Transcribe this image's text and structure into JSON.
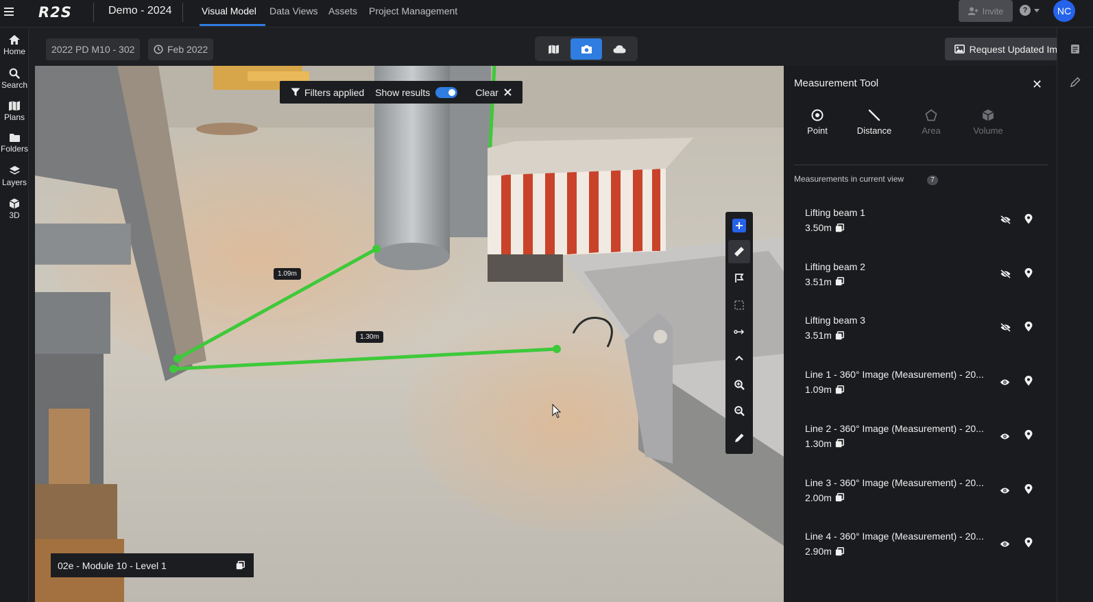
{
  "header": {
    "logo": "R2S",
    "project_title": "Demo - 2024",
    "tabs": [
      {
        "label": "Visual Model",
        "active": true
      },
      {
        "label": "Data Views"
      },
      {
        "label": "Assets"
      },
      {
        "label": "Project Management"
      }
    ],
    "invite_label": "Invite",
    "help_label": "?",
    "avatar_initials": "NC"
  },
  "left_rail": {
    "items": [
      {
        "label": "Home",
        "icon": "home-icon"
      },
      {
        "label": "Search",
        "icon": "search-icon"
      },
      {
        "label": "Plans",
        "icon": "map-icon"
      },
      {
        "label": "Folders",
        "icon": "folder-icon"
      },
      {
        "label": "Layers",
        "icon": "layers-icon"
      },
      {
        "label": "3D",
        "icon": "cube-icon"
      }
    ]
  },
  "subbar": {
    "scan_chip": "2022 PD M10 - 302",
    "date_chip": "Feb 2022",
    "view_modes": [
      "map-icon",
      "camera-icon",
      "cloud-icon"
    ],
    "active_view_mode": "camera-icon",
    "request_label": "Request Updated Images"
  },
  "viewer": {
    "filters_label": "Filters applied",
    "show_results_label": "Show results",
    "show_results_on": true,
    "clear_label": "Clear",
    "measure_labels": [
      "1.09m",
      "1.30m"
    ],
    "location_label": "02e - Module 10 - Level 1",
    "line_color": "#3ec93a"
  },
  "measurement_panel": {
    "title": "Measurement Tool",
    "tools": [
      {
        "label": "Point",
        "enabled": true
      },
      {
        "label": "Distance",
        "enabled": true
      },
      {
        "label": "Area",
        "enabled": false
      },
      {
        "label": "Volume",
        "enabled": false
      }
    ],
    "section_label": "Measurements in current view",
    "count": "7",
    "items": [
      {
        "name": "Lifting beam 1",
        "value": "3.50m",
        "visible": false
      },
      {
        "name": "Lifting beam 2",
        "value": "3.51m",
        "visible": false
      },
      {
        "name": "Lifting beam 3",
        "value": "3.51m",
        "visible": false
      },
      {
        "name": "Line 1 - 360° Image (Measurement) - 20...",
        "value": "1.09m",
        "visible": true
      },
      {
        "name": "Line 2 - 360° Image (Measurement) - 20...",
        "value": "1.30m",
        "visible": true
      },
      {
        "name": "Line 3 - 360° Image (Measurement) - 20...",
        "value": "2.00m",
        "visible": true
      },
      {
        "name": "Line 4 - 360° Image (Measurement) - 20...",
        "value": "2.90m",
        "visible": true
      }
    ]
  },
  "colors": {
    "accent": "#2f7de1",
    "panel_bg": "#1a1b1e",
    "measure_line": "#3ec93a"
  }
}
